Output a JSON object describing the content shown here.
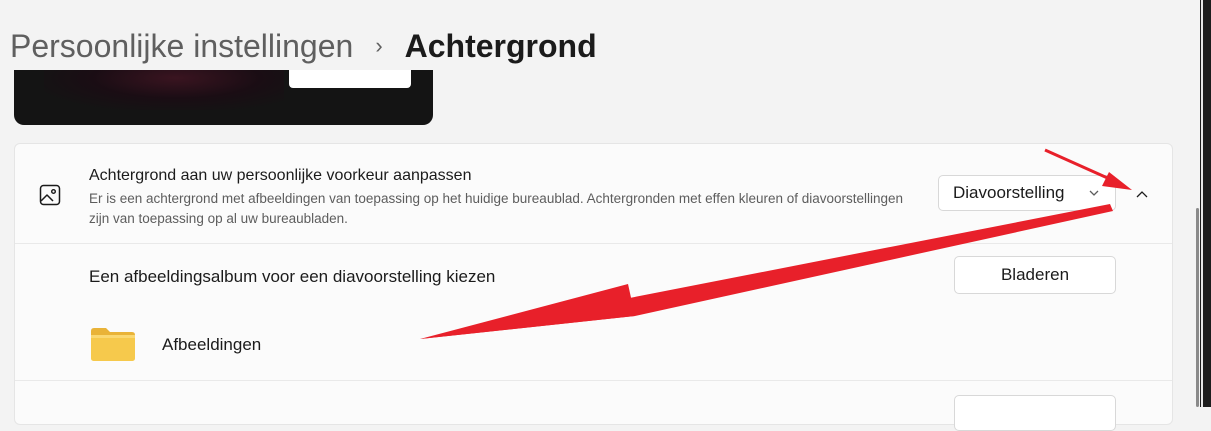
{
  "breadcrumb": {
    "parent": "Persoonlijke instellingen",
    "separator": "›",
    "current": "Achtergrond"
  },
  "background_setting": {
    "icon": "image-icon",
    "title": "Achtergrond aan uw persoonlijke voorkeur aanpassen",
    "description": "Er is een achtergrond met afbeeldingen van toepassing op het huidige bureaublad. Achtergronden met effen kleuren of diavoorstellingen zijn van toepassing op al uw bureaubladen.",
    "dropdown_value": "Diavoorstelling",
    "expanded": true
  },
  "album": {
    "label": "Een afbeeldingsalbum voor een diavoorstelling kiezen",
    "browse_label": "Bladeren",
    "folder_name": "Afbeeldingen",
    "folder_icon": "folder-icon"
  },
  "colors": {
    "annotation_arrow": "#e8202a",
    "page_background": "#f3f3f3",
    "card_background": "#fbfbfb",
    "folder": "#f6c94c"
  }
}
